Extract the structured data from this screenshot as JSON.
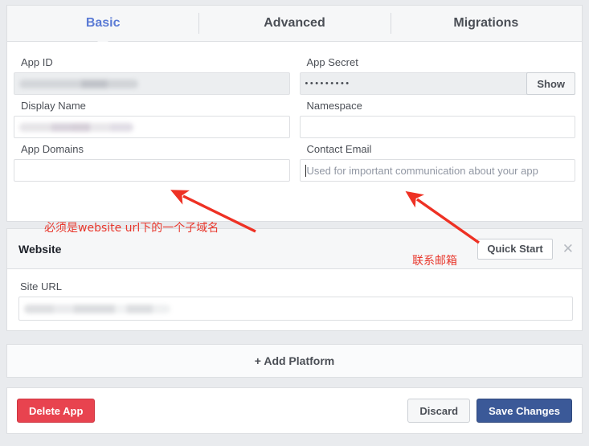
{
  "tabs": [
    {
      "label": "Basic",
      "active": true
    },
    {
      "label": "Advanced",
      "active": false
    },
    {
      "label": "Migrations",
      "active": false
    }
  ],
  "basic_form": {
    "app_id": {
      "label": "App ID",
      "value": "",
      "redacted": true,
      "readonly": true
    },
    "app_secret": {
      "label": "App Secret",
      "value": "•••••••••",
      "show_button": "Show"
    },
    "display_name": {
      "label": "Display Name",
      "value": "",
      "redacted": true
    },
    "namespace": {
      "label": "Namespace",
      "value": "",
      "placeholder": ""
    },
    "app_domains": {
      "label": "App Domains",
      "value": "",
      "placeholder": ""
    },
    "contact_email": {
      "label": "Contact Email",
      "value": "",
      "placeholder": "Used for important communication about your app",
      "focused": true
    }
  },
  "platform": {
    "title": "Website",
    "quick_start_label": "Quick Start",
    "close_icon": "close-icon",
    "site_url": {
      "label": "Site URL",
      "value": "",
      "redacted": true
    }
  },
  "add_platform": {
    "label": "+ Add Platform"
  },
  "footer": {
    "delete_label": "Delete App",
    "discard_label": "Discard",
    "save_label": "Save Changes"
  },
  "annotations": [
    {
      "id": "left",
      "text": "必须是website url下的一个子域名"
    },
    {
      "id": "right",
      "text": "联系邮箱"
    }
  ],
  "colors": {
    "accent_blue": "#3b5998",
    "active_tab": "#5b7bd5",
    "danger_red": "#e8434f",
    "annotation_red": "#e8372c",
    "page_bg": "#e9ebee"
  }
}
